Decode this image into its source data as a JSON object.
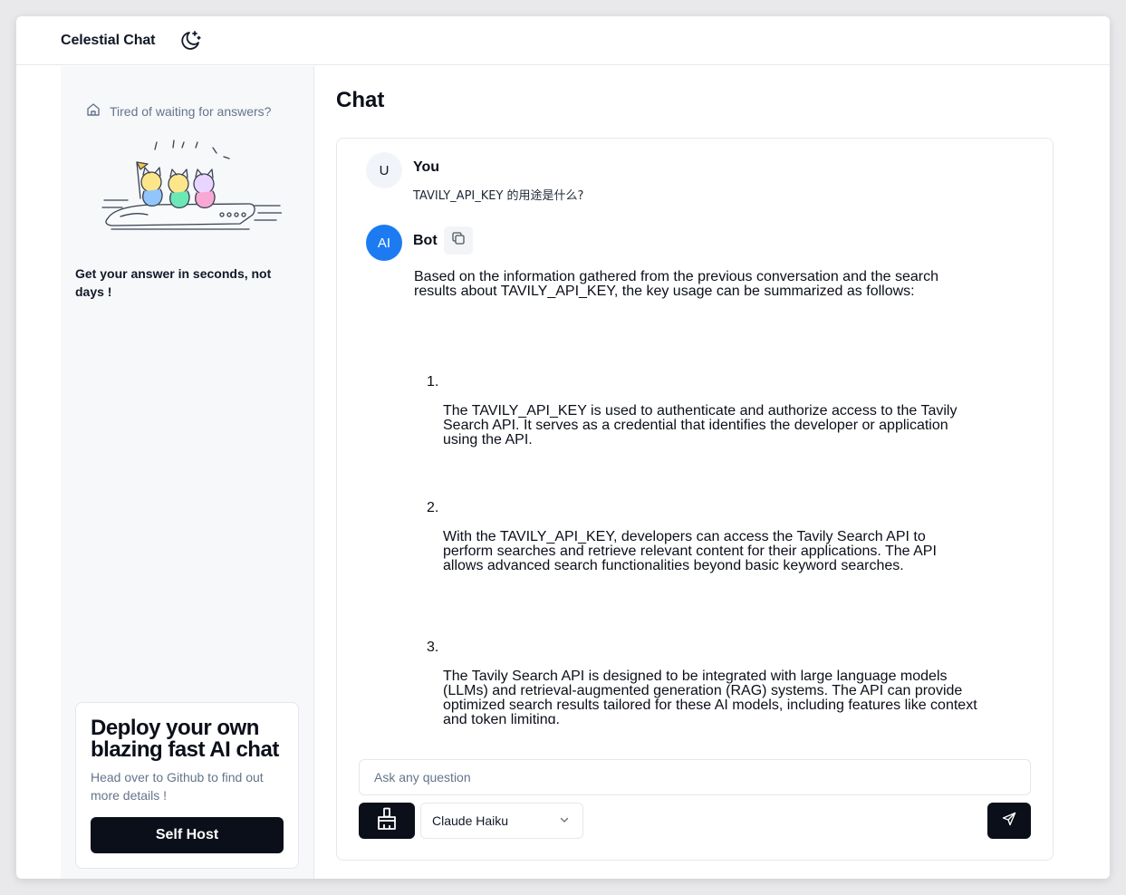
{
  "app": {
    "title": "Celestial Chat",
    "theme_icon": "moon-stars-icon"
  },
  "sidebar": {
    "promo_link": "Tired of waiting for answers?",
    "promo_icon": "home-icon",
    "tagline": "Get your answer in seconds, not days !",
    "deploy_card": {
      "title": "Deploy your own blazing fast AI chat",
      "description": "Head over to Github to find out more details !",
      "button_label": "Self Host"
    }
  },
  "main": {
    "title": "Chat",
    "messages": {
      "user": {
        "avatar": "U",
        "name": "You",
        "text": "TAVILY_API_KEY 的用途是什么?"
      },
      "bot": {
        "avatar": "AI",
        "name": "Bot",
        "copy_icon": "copy-icon",
        "intro": "Based on the information gathered from the previous conversation and the search results about TAVILY_API_KEY, the key usage can be summarized as follows:",
        "items": [
          {
            "num": "1.",
            "text": "The TAVILY_API_KEY is used to authenticate and authorize access to the Tavily Search API. It serves as a credential that identifies the developer or application using the API."
          },
          {
            "num": "2.",
            "text": "With the TAVILY_API_KEY, developers can access the Tavily Search API to perform searches and retrieve relevant content for their applications. The API allows advanced search functionalities beyond basic keyword searches."
          },
          {
            "num": "3.",
            "text": "The Tavily Search API is designed to be integrated with large language models (LLMs) and retrieval-augmented generation (RAG) systems. The API can provide optimized search results tailored for these AI models, including features like context and token limiting."
          }
        ]
      }
    },
    "composer": {
      "placeholder": "Ask any question",
      "clear_icon": "brush-icon",
      "model": "Claude Haiku",
      "send_icon": "send-icon"
    }
  },
  "colors": {
    "accent_blue": "#1d7bf2",
    "dark_button": "#0b0f19",
    "muted_text": "#64748b",
    "sidebar_bg": "#f7f8fa"
  }
}
